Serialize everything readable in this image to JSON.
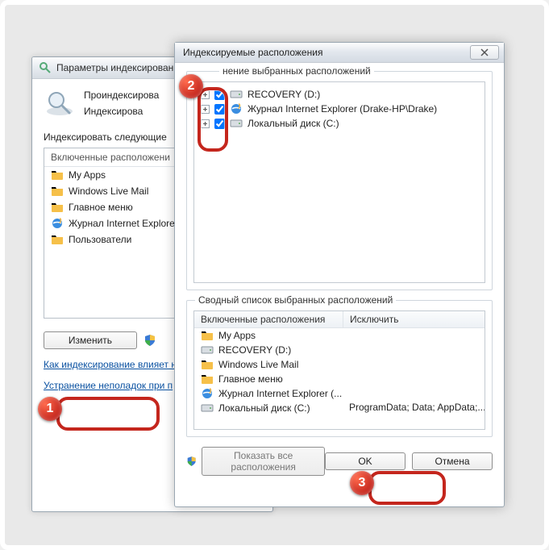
{
  "badges": {
    "b1": "1",
    "b2": "2",
    "b3": "3"
  },
  "back_window": {
    "title": "Параметры индексирования",
    "line1": "Проиндексирова",
    "line2": "Индексирова",
    "section": "Индексировать следующие",
    "list_header": "Включенные расположени",
    "items": [
      {
        "kind": "folder",
        "label": "My Apps"
      },
      {
        "kind": "folder",
        "label": "Windows Live Mail"
      },
      {
        "kind": "folder",
        "label": "Главное меню"
      },
      {
        "kind": "ie",
        "label": "Журнал Internet Explore"
      },
      {
        "kind": "folder",
        "label": "Пользователи"
      }
    ],
    "modify_btn": "Изменить",
    "link1": "Как индексирование влияет н",
    "link2": "Устранение неполадок при п"
  },
  "front_window": {
    "title": "Индексируемые расположения",
    "group1": "нение выбранных расположений",
    "tree": [
      {
        "kind": "hdd",
        "label": "RECOVERY (D:)"
      },
      {
        "kind": "ie",
        "label": "Журнал Internet Explorer (Drake-HP\\Drake)"
      },
      {
        "kind": "hdd",
        "label": "Локальный диск (C:)"
      }
    ],
    "group2": "Сводный список выбранных расположений",
    "col_included": "Включенные расположения",
    "col_exclude": "Исключить",
    "summary": [
      {
        "kind": "folder",
        "label": "My Apps",
        "exclude": ""
      },
      {
        "kind": "hdd",
        "label": "RECOVERY (D:)",
        "exclude": ""
      },
      {
        "kind": "folder",
        "label": "Windows Live Mail",
        "exclude": ""
      },
      {
        "kind": "folder",
        "label": "Главное меню",
        "exclude": ""
      },
      {
        "kind": "ie",
        "label": "Журнал Internet Explorer (...",
        "exclude": ""
      },
      {
        "kind": "hdd",
        "label": "Локальный диск (C:)",
        "exclude": "ProgramData; Data; AppData;..."
      }
    ],
    "show_all": "Показать все расположения",
    "ok": "OK",
    "cancel": "Отмена"
  }
}
